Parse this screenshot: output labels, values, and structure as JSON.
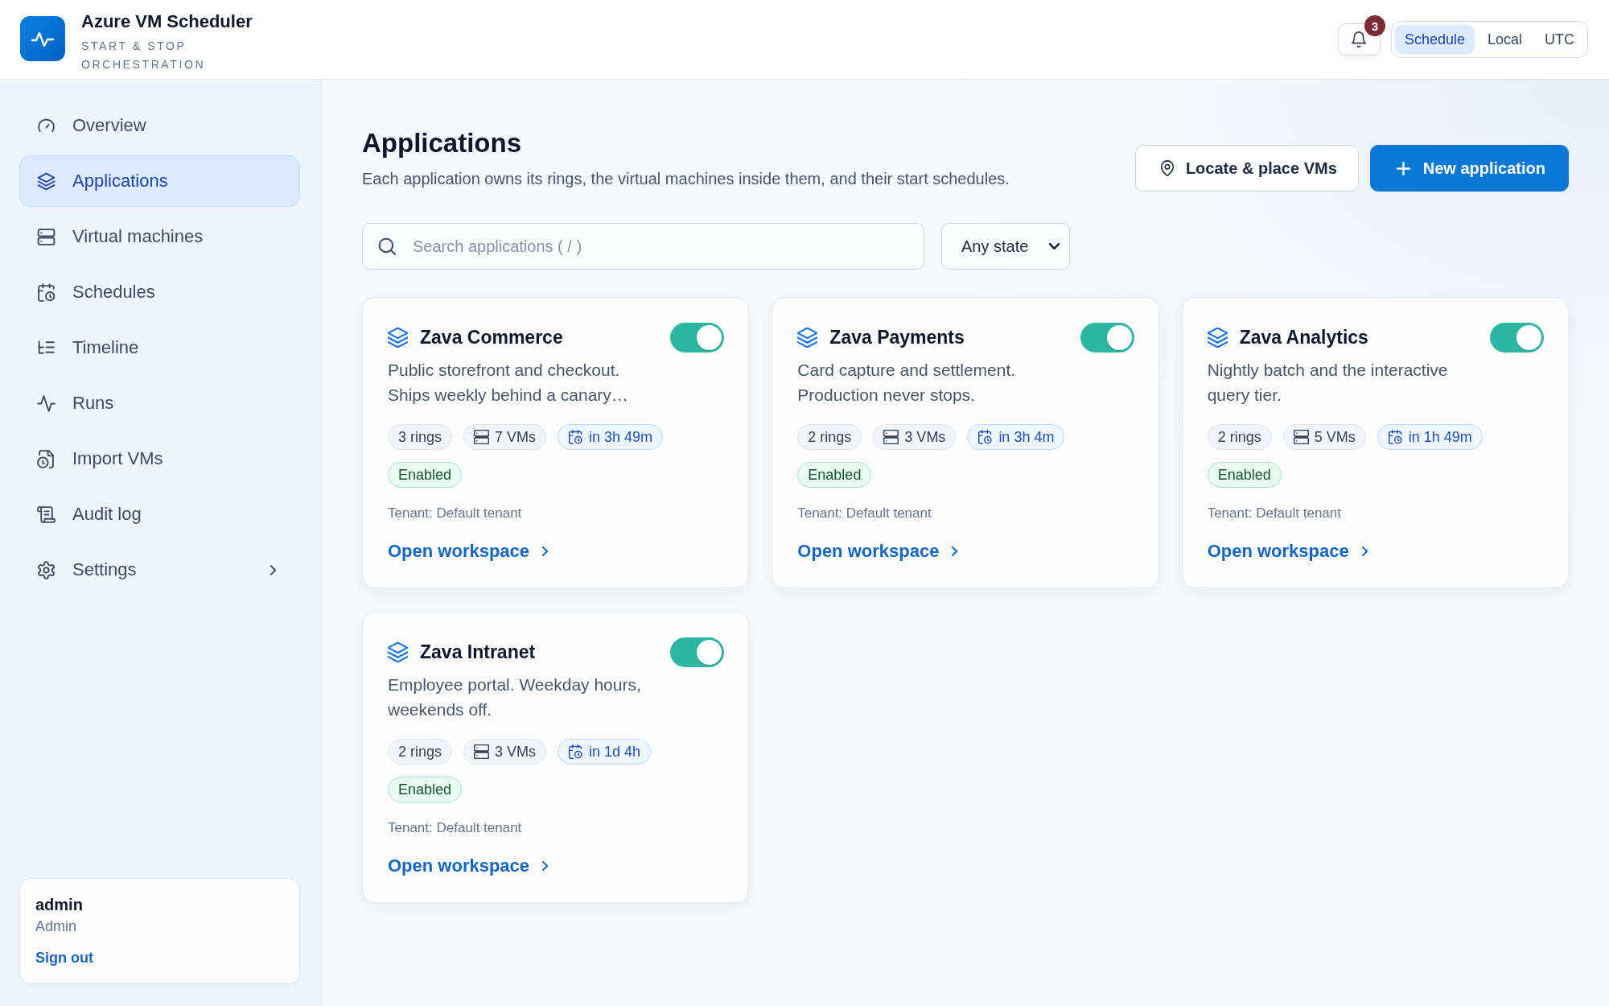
{
  "app": {
    "title": "Azure VM Scheduler",
    "subtitle": "START & STOP ORCHESTRATION"
  },
  "header": {
    "notifications": {
      "count": "3"
    },
    "time_modes": [
      {
        "label": "Schedule",
        "selected": true
      },
      {
        "label": "Local",
        "selected": false
      },
      {
        "label": "UTC",
        "selected": false
      }
    ]
  },
  "sidebar": {
    "items": [
      {
        "label": "Overview",
        "selected": false,
        "has_submenu": false
      },
      {
        "label": "Applications",
        "selected": true,
        "has_submenu": false
      },
      {
        "label": "Virtual machines",
        "selected": false,
        "has_submenu": false
      },
      {
        "label": "Schedules",
        "selected": false,
        "has_submenu": false
      },
      {
        "label": "Timeline",
        "selected": false,
        "has_submenu": false
      },
      {
        "label": "Runs",
        "selected": false,
        "has_submenu": false
      },
      {
        "label": "Import VMs",
        "selected": false,
        "has_submenu": false
      },
      {
        "label": "Audit log",
        "selected": false,
        "has_submenu": false
      },
      {
        "label": "Settings",
        "selected": false,
        "has_submenu": true
      }
    ],
    "user": {
      "name": "admin",
      "role": "Admin",
      "sign_out": "Sign out"
    }
  },
  "page": {
    "title": "Applications",
    "subtitle": "Each application owns its rings, the virtual machines inside them, and their start schedules.",
    "actions": [
      {
        "label": "Locate & place VMs",
        "kind": "secondary"
      },
      {
        "label": "New application",
        "kind": "primary"
      }
    ],
    "search": {
      "placeholder": "Search applications ( / )"
    },
    "state_filter": {
      "value": "Any state"
    }
  },
  "applications": [
    {
      "name": "Zava Commerce",
      "on": true,
      "description": "Public storefront and checkout. Ships weekly behind a canary…",
      "rings": "3 rings",
      "vms": "7 VMs",
      "next_start": "in 3h 49m",
      "status": "Enabled",
      "tenant": "Tenant: Default tenant",
      "link": "Open workspace"
    },
    {
      "name": "Zava Payments",
      "on": true,
      "description": "Card capture and settlement. Production never stops.",
      "rings": "2 rings",
      "vms": "3 VMs",
      "next_start": "in 3h 4m",
      "status": "Enabled",
      "tenant": "Tenant: Default tenant",
      "link": "Open workspace"
    },
    {
      "name": "Zava Analytics",
      "on": true,
      "description": "Nightly batch and the interactive query tier.",
      "rings": "2 rings",
      "vms": "5 VMs",
      "next_start": "in 1h 49m",
      "status": "Enabled",
      "tenant": "Tenant: Default tenant",
      "link": "Open workspace"
    },
    {
      "name": "Zava Intranet",
      "on": true,
      "description": "Employee portal. Weekday hours, weekends off.",
      "rings": "2 rings",
      "vms": "3 VMs",
      "next_start": "in 1d 4h",
      "status": "Enabled",
      "tenant": "Tenant: Default tenant",
      "link": "Open workspace"
    }
  ]
}
